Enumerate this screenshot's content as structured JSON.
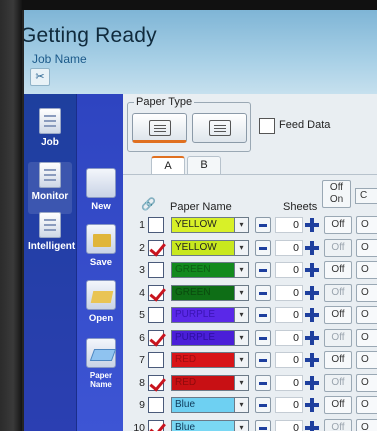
{
  "header": {
    "title": "Getting Ready",
    "subtitle": "Job Name",
    "cut_icon": "cut-icon"
  },
  "sidebar": {
    "items": [
      {
        "label": "Job",
        "icon": "document-icon"
      },
      {
        "label": "Monitor",
        "icon": "monitor-icon"
      },
      {
        "label": "Intelligent",
        "icon": "intelligent-icon"
      }
    ]
  },
  "tools": [
    {
      "label": "New",
      "icon": "new-page-icon"
    },
    {
      "label": "Save",
      "icon": "save-folder-icon"
    },
    {
      "label": "Open",
      "icon": "open-folder-icon"
    },
    {
      "label": "Paper Name",
      "icon": "paper-name-icon"
    }
  ],
  "paper_type": {
    "label": "Paper Type",
    "feed_data_label": "Feed Data"
  },
  "tabs": [
    "A",
    "B"
  ],
  "table": {
    "col_name": "Paper Name",
    "col_sheets": "Sheets",
    "offon_top": "Off",
    "offon_bottom": "On",
    "edge_header": "C",
    "rows": [
      {
        "num": "1",
        "checked": false,
        "name": "YELLOW",
        "color": "#d8f028",
        "text_color": "#222222",
        "sheets": "0",
        "state": "Off",
        "edge": "O"
      },
      {
        "num": "2",
        "checked": true,
        "name": "YELLOW",
        "color": "#c8e81e",
        "text_color": "#222222",
        "sheets": "0",
        "state": "Off",
        "edge": "O"
      },
      {
        "num": "3",
        "checked": false,
        "name": "GREEN",
        "color": "#128a1e",
        "text_color": "#0e5e14",
        "sheets": "0",
        "state": "Off",
        "edge": "O"
      },
      {
        "num": "4",
        "checked": true,
        "name": "GREEN",
        "color": "#0e6e16",
        "text_color": "#0a4a0e",
        "sheets": "0",
        "state": "Off",
        "edge": "O"
      },
      {
        "num": "5",
        "checked": false,
        "name": "PURPLE",
        "color": "#5a28e8",
        "text_color": "#3a14b4",
        "sheets": "0",
        "state": "Off",
        "edge": "O"
      },
      {
        "num": "6",
        "checked": true,
        "name": "PURPLE",
        "color": "#4a1ed8",
        "text_color": "#2e0ea0",
        "sheets": "0",
        "state": "Off",
        "edge": "O"
      },
      {
        "num": "7",
        "checked": false,
        "name": "RED",
        "color": "#d81418",
        "text_color": "#a00c10",
        "sheets": "0",
        "state": "Off",
        "edge": "O"
      },
      {
        "num": "8",
        "checked": true,
        "name": "RED",
        "color": "#c81014",
        "text_color": "#900a0c",
        "sheets": "0",
        "state": "Off",
        "edge": "O"
      },
      {
        "num": "9",
        "checked": false,
        "name": "Blue",
        "color": "#6ed0f2",
        "text_color": "#0e3a5a",
        "sheets": "0",
        "state": "Off",
        "edge": "O"
      },
      {
        "num": "10",
        "checked": true,
        "name": "Blue",
        "color": "#7ad8f4",
        "text_color": "#0e3a5a",
        "sheets": "0",
        "state": "Off",
        "edge": "O"
      }
    ]
  }
}
